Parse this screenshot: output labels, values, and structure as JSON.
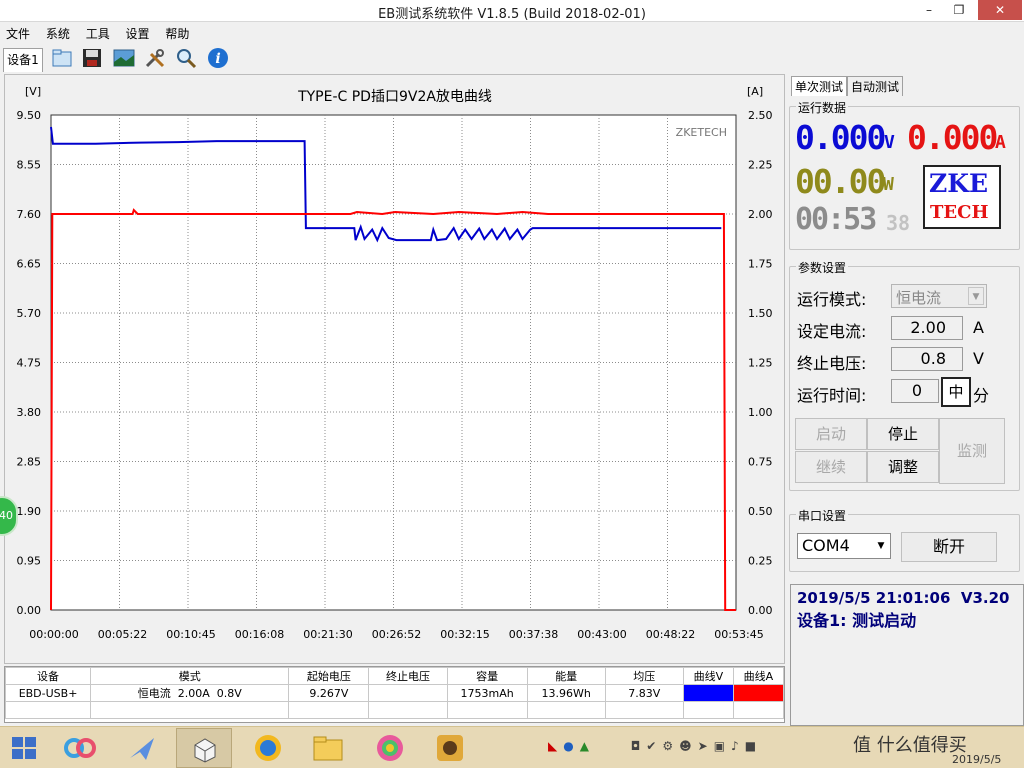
{
  "window": {
    "title": "EB测试系统软件 V1.8.5 (Build 2018-02-01)",
    "min_glyph": "–",
    "max_glyph": "❐",
    "close_glyph": "✕"
  },
  "menu": [
    "文件",
    "系统",
    "工具",
    "设置",
    "帮助"
  ],
  "toolbar": {
    "device_tab": "设备1",
    "icons": [
      "folder-icon",
      "save-icon",
      "picture-icon",
      "tools-icon",
      "search-icon",
      "info-icon"
    ]
  },
  "chart_data": {
    "type": "line",
    "title": "TYPE-C PD插口9V2A放电曲线",
    "watermark": "ZKETECH",
    "left_unit": "[V]",
    "right_unit": "[A]",
    "ylim_left": [
      0,
      9.5
    ],
    "ylim_right": [
      0,
      2.5
    ],
    "y_ticks_left": [
      "9.50",
      "8.55",
      "7.60",
      "6.65",
      "5.70",
      "4.75",
      "3.80",
      "2.85",
      "1.90",
      "0.95",
      "0.00"
    ],
    "y_ticks_right": [
      "2.50",
      "2.25",
      "2.00",
      "1.75",
      "1.50",
      "1.25",
      "1.00",
      "0.75",
      "0.50",
      "0.25",
      "0.00"
    ],
    "x_ticks": [
      "00:00:00",
      "00:05:22",
      "00:10:45",
      "00:16:08",
      "00:21:30",
      "00:26:52",
      "00:32:15",
      "00:37:38",
      "00:43:00",
      "00:48:22",
      "00:53:45"
    ],
    "xlim_minutes": [
      0,
      53.75
    ],
    "series": [
      {
        "name": "曲线V",
        "axis": "left",
        "color": "#0000cc",
        "points": [
          [
            0,
            9.27
          ],
          [
            0.15,
            8.95
          ],
          [
            3.5,
            8.95
          ],
          [
            7.0,
            8.97
          ],
          [
            10.0,
            8.98
          ],
          [
            13.0,
            9.0
          ],
          [
            19.9,
            9.0
          ],
          [
            20.0,
            7.33
          ],
          [
            23.8,
            7.33
          ],
          [
            23.9,
            7.1
          ],
          [
            24.3,
            7.35
          ],
          [
            24.6,
            7.12
          ],
          [
            25.2,
            7.3
          ],
          [
            25.6,
            7.1
          ],
          [
            26.0,
            7.33
          ],
          [
            26.5,
            7.14
          ],
          [
            27.1,
            7.1
          ],
          [
            29.8,
            7.1
          ],
          [
            30.0,
            7.3
          ],
          [
            30.3,
            7.1
          ],
          [
            31.0,
            7.12
          ],
          [
            31.6,
            7.33
          ],
          [
            32.0,
            7.12
          ],
          [
            32.5,
            7.3
          ],
          [
            33.0,
            7.12
          ],
          [
            33.6,
            7.32
          ],
          [
            34.0,
            7.12
          ],
          [
            34.6,
            7.3
          ],
          [
            35.0,
            7.12
          ],
          [
            35.6,
            7.32
          ],
          [
            36.0,
            7.12
          ],
          [
            36.6,
            7.3
          ],
          [
            37.0,
            7.12
          ],
          [
            37.6,
            7.3
          ],
          [
            37.8,
            7.33
          ],
          [
            44.0,
            7.33
          ],
          [
            52.6,
            7.33
          ]
        ]
      },
      {
        "name": "曲线A",
        "axis": "right",
        "color": "#ff0000",
        "points": [
          [
            0,
            0
          ],
          [
            0.1,
            2.0
          ],
          [
            6.4,
            2.0
          ],
          [
            6.5,
            2.02
          ],
          [
            6.8,
            2.0
          ],
          [
            23.5,
            2.0
          ],
          [
            24.0,
            2.01
          ],
          [
            26.0,
            2.0
          ],
          [
            27.0,
            2.01
          ],
          [
            30.0,
            2.0
          ],
          [
            32.0,
            2.01
          ],
          [
            35.0,
            2.0
          ],
          [
            37.0,
            2.01
          ],
          [
            39.0,
            2.0
          ],
          [
            52.8,
            2.0
          ],
          [
            52.9,
            0
          ],
          [
            53.75,
            0
          ]
        ]
      }
    ]
  },
  "table": {
    "headers": [
      "设备",
      "模式",
      "起始电压",
      "终止电压",
      "容量",
      "能量",
      "均压",
      "曲线V",
      "曲线A"
    ],
    "row": [
      "EBD-USB+",
      "恒电流  2.00A  0.8V",
      "9.267V",
      "",
      "1753mAh",
      "13.96Wh",
      "7.83V",
      "",
      ""
    ],
    "swatch_v": "#0000ff",
    "swatch_a": "#ff0000"
  },
  "right": {
    "tabs": [
      "单次测试",
      "自动测试"
    ],
    "run_data_title": "运行数据",
    "voltage": "0.000",
    "voltage_unit": "V",
    "current": "0.000",
    "current_unit": "A",
    "power": "00.00",
    "power_unit": "W",
    "time": "00:53",
    "time_seconds": "38",
    "logo_line1": "ZKE",
    "logo_line2": "TECH",
    "params_title": "参数设置",
    "mode_label": "运行模式:",
    "mode_value": "恒电流",
    "current_label": "设定电流:",
    "current_value": "2.00",
    "current_value_unit": "A",
    "stop_label": "终止电压:",
    "stop_value": "0.8",
    "stop_unit": "V",
    "time_label": "运行时间:",
    "time_value": "0",
    "time_mid": "中",
    "time_unit": "分",
    "btn_start": "启动",
    "btn_stop": "停止",
    "btn_monitor": "监测",
    "btn_continue": "继续",
    "btn_adjust": "调整",
    "serial_title": "串口设置",
    "com_value": "COM4",
    "btn_disconnect": "断开",
    "log_line1": "2019/5/5 21:01:06  V3.20",
    "log_line2": "设备1: 测试启动"
  },
  "taskbar": {
    "clock_watermark": "值 什么值得买",
    "date": "2019/5/5",
    "side_badge": "40"
  }
}
